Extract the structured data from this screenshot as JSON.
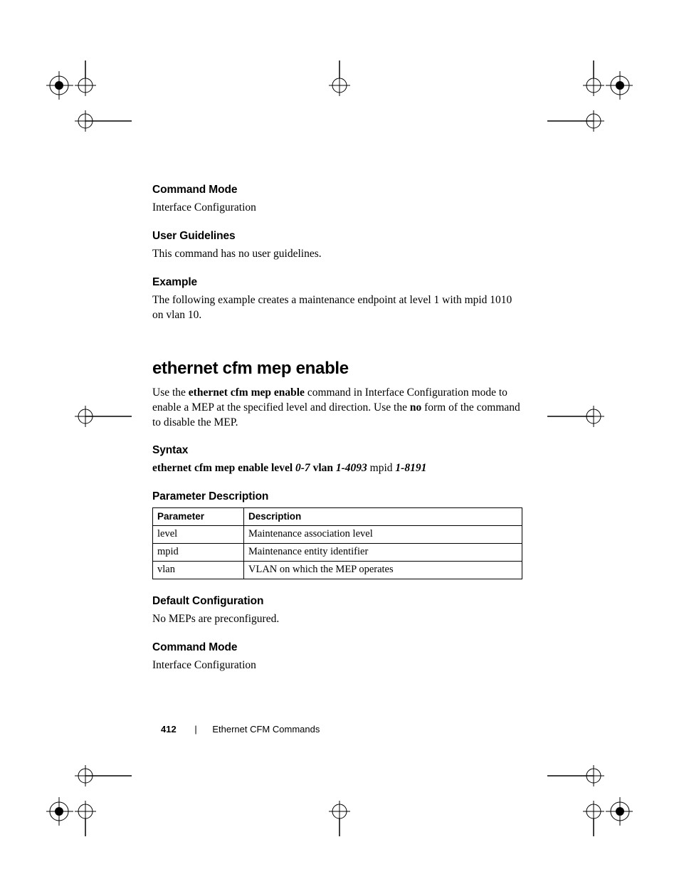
{
  "sections": {
    "command_mode_1": {
      "heading": "Command Mode",
      "body": "Interface Configuration"
    },
    "user_guidelines": {
      "heading": "User Guidelines",
      "body": "This command has no user guidelines."
    },
    "example": {
      "heading": "Example",
      "body": "The following example creates a maintenance endpoint at level 1 with mpid 1010 on vlan 10."
    },
    "command_title": "ethernet cfm mep enable",
    "intro": {
      "pre": "Use the ",
      "cmd": "ethernet cfm mep enable",
      "mid": " command in Interface Configuration mode to enable a MEP at the specified level and direction. Use the ",
      "no": "no",
      "post": " form of the command to disable the MEP."
    },
    "syntax": {
      "heading": "Syntax",
      "parts": {
        "p1": "ethernet cfm mep enable level ",
        "i1": "0-7",
        "p2": " vlan ",
        "i2": "1-4093",
        "p3": " mpid ",
        "i3": "1-8191"
      }
    },
    "param_desc_heading": "Parameter Description",
    "table": {
      "head_param": "Parameter",
      "head_desc": "Description",
      "rows": [
        {
          "param": "level",
          "desc": "Maintenance association level"
        },
        {
          "param": "mpid",
          "desc": "Maintenance entity identifier"
        },
        {
          "param": "vlan",
          "desc": "VLAN on which the MEP operates"
        }
      ]
    },
    "default_config": {
      "heading": "Default Configuration",
      "body": "No MEPs are preconfigured."
    },
    "command_mode_2": {
      "heading": "Command Mode",
      "body": "Interface Configuration"
    }
  },
  "footer": {
    "page_number": "412",
    "chapter": "Ethernet CFM Commands"
  }
}
